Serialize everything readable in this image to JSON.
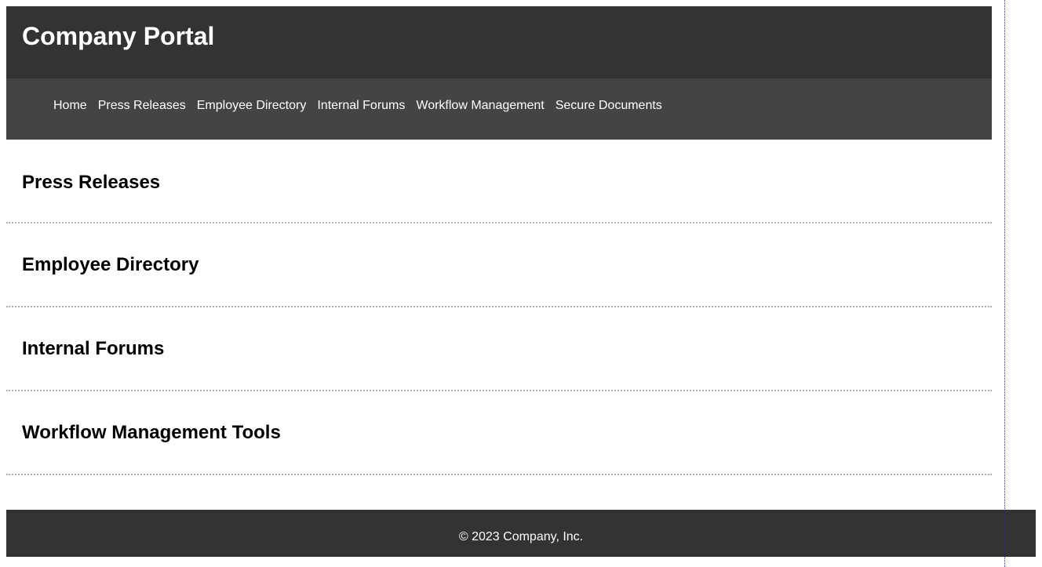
{
  "header": {
    "title": "Company Portal"
  },
  "nav": {
    "items": [
      {
        "label": "Home"
      },
      {
        "label": "Press Releases"
      },
      {
        "label": "Employee Directory"
      },
      {
        "label": "Internal Forums"
      },
      {
        "label": "Workflow Management"
      },
      {
        "label": "Secure Documents"
      }
    ]
  },
  "sections": [
    {
      "title": "Press Releases"
    },
    {
      "title": "Employee Directory"
    },
    {
      "title": "Internal Forums"
    },
    {
      "title": "Workflow Management Tools"
    },
    {
      "title": ""
    }
  ],
  "footer": {
    "copyright": "© 2023 Company, Inc."
  }
}
